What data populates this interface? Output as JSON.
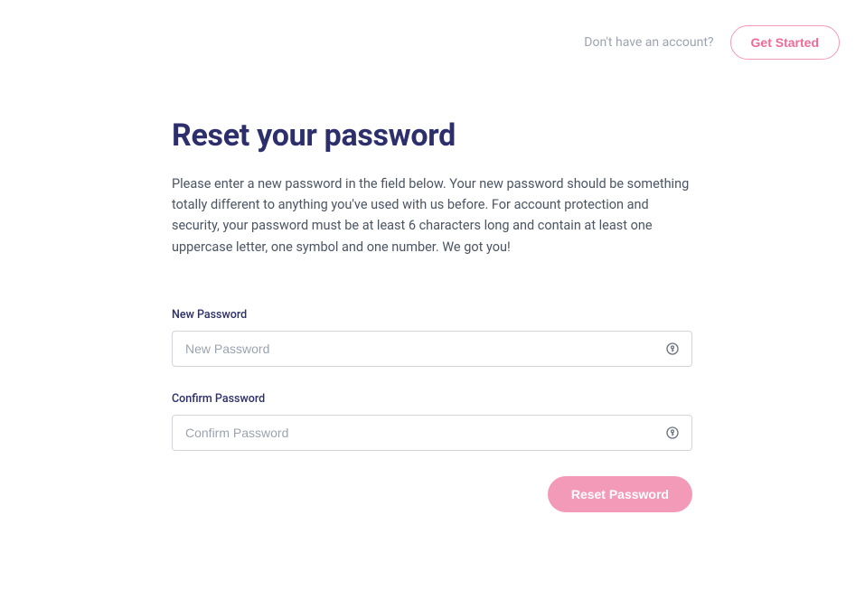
{
  "header": {
    "prompt": "Don't have an account?",
    "get_started": "Get Started"
  },
  "page": {
    "title": "Reset your password",
    "instructions": "Please enter a new password in the field below. Your new password should be something totally different to anything you've used with us before. For account protection and security, your password must be at least 6 characters long and contain at least one uppercase letter, one symbol and one number. We got you!"
  },
  "form": {
    "new_password": {
      "label": "New Password",
      "placeholder": "New Password",
      "value": ""
    },
    "confirm_password": {
      "label": "Confirm Password",
      "placeholder": "Confirm Password",
      "value": ""
    },
    "submit_label": "Reset Password"
  },
  "icons": {
    "password_manager": "password-key-icon"
  }
}
